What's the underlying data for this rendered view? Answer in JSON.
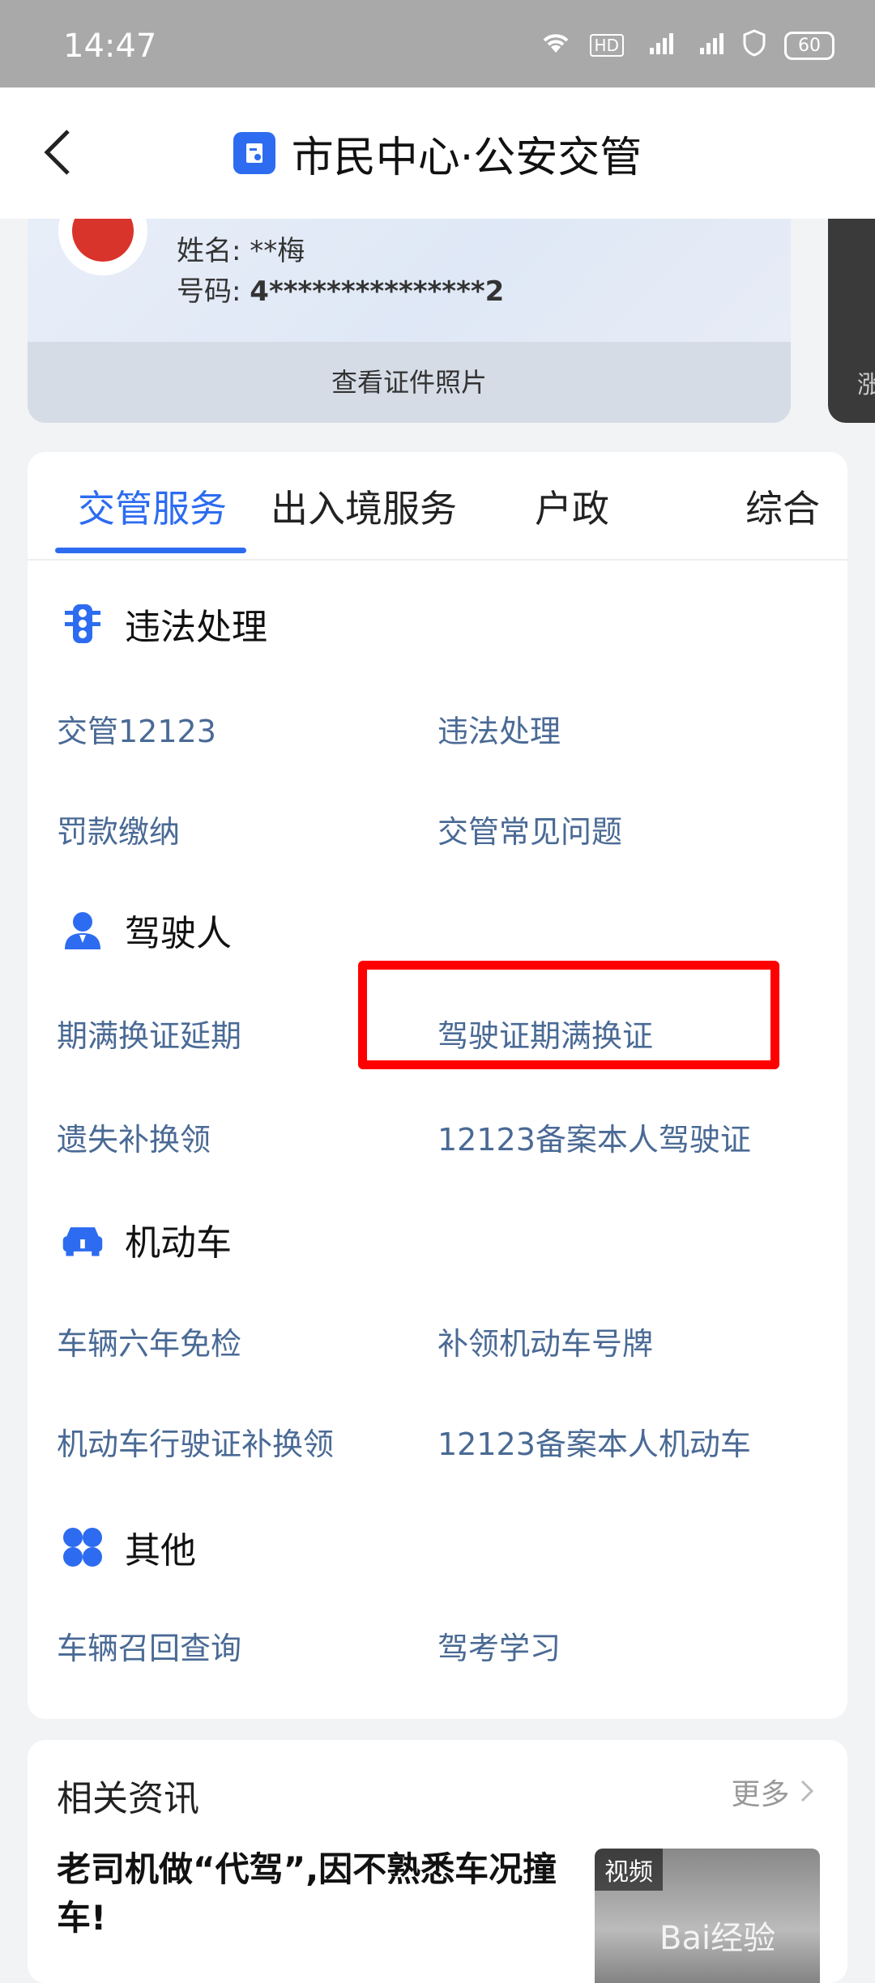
{
  "status_bar": {
    "time": "14:47",
    "battery": "60",
    "icons": [
      "wifi-icon",
      "hd-icon",
      "signal-4g-icon",
      "signal-4g-icon",
      "shield-icon"
    ]
  },
  "header": {
    "back_icon": "chevron-left-icon",
    "title": "市民中心·公安交管"
  },
  "id_card": {
    "name_label": "姓名:",
    "name_value": "**梅",
    "number_label": "号码:",
    "number_value": "4***************2",
    "view_photo": "查看证件照片"
  },
  "second_card": {
    "partial_text": "涨"
  },
  "tabs": [
    {
      "label": "交管服务",
      "active": true
    },
    {
      "label": "出入境服务",
      "active": false
    },
    {
      "label": "户政",
      "active": false
    },
    {
      "label": "综合",
      "active": false
    }
  ],
  "sections": [
    {
      "title": "违法处理",
      "icon": "traffic-light-icon",
      "links": [
        "交管12123",
        "违法处理",
        "罚款缴纳",
        "交管常见问题"
      ]
    },
    {
      "title": "驾驶人",
      "icon": "driver-icon",
      "links": [
        "期满换证延期",
        "驾驶证期满换证",
        "遗失补换领",
        "12123备案本人驾驶证"
      ]
    },
    {
      "title": "机动车",
      "icon": "car-icon",
      "links": [
        "车辆六年免检",
        "补领机动车号牌",
        "机动车行驶证补换领",
        "12123备案本人机动车"
      ]
    },
    {
      "title": "其他",
      "icon": "clover-icon",
      "links": [
        "车辆召回查询",
        "驾考学习"
      ]
    }
  ],
  "news": {
    "title": "相关资讯",
    "more": "更多",
    "headline": "老司机做“代驾”,因不熟悉车况撞车!",
    "thumb_tag": "视频",
    "watermark": "Bai经验"
  },
  "colors": {
    "accent": "#2d6cf0",
    "link": "#4a6a95",
    "highlight": "#ff0000"
  }
}
